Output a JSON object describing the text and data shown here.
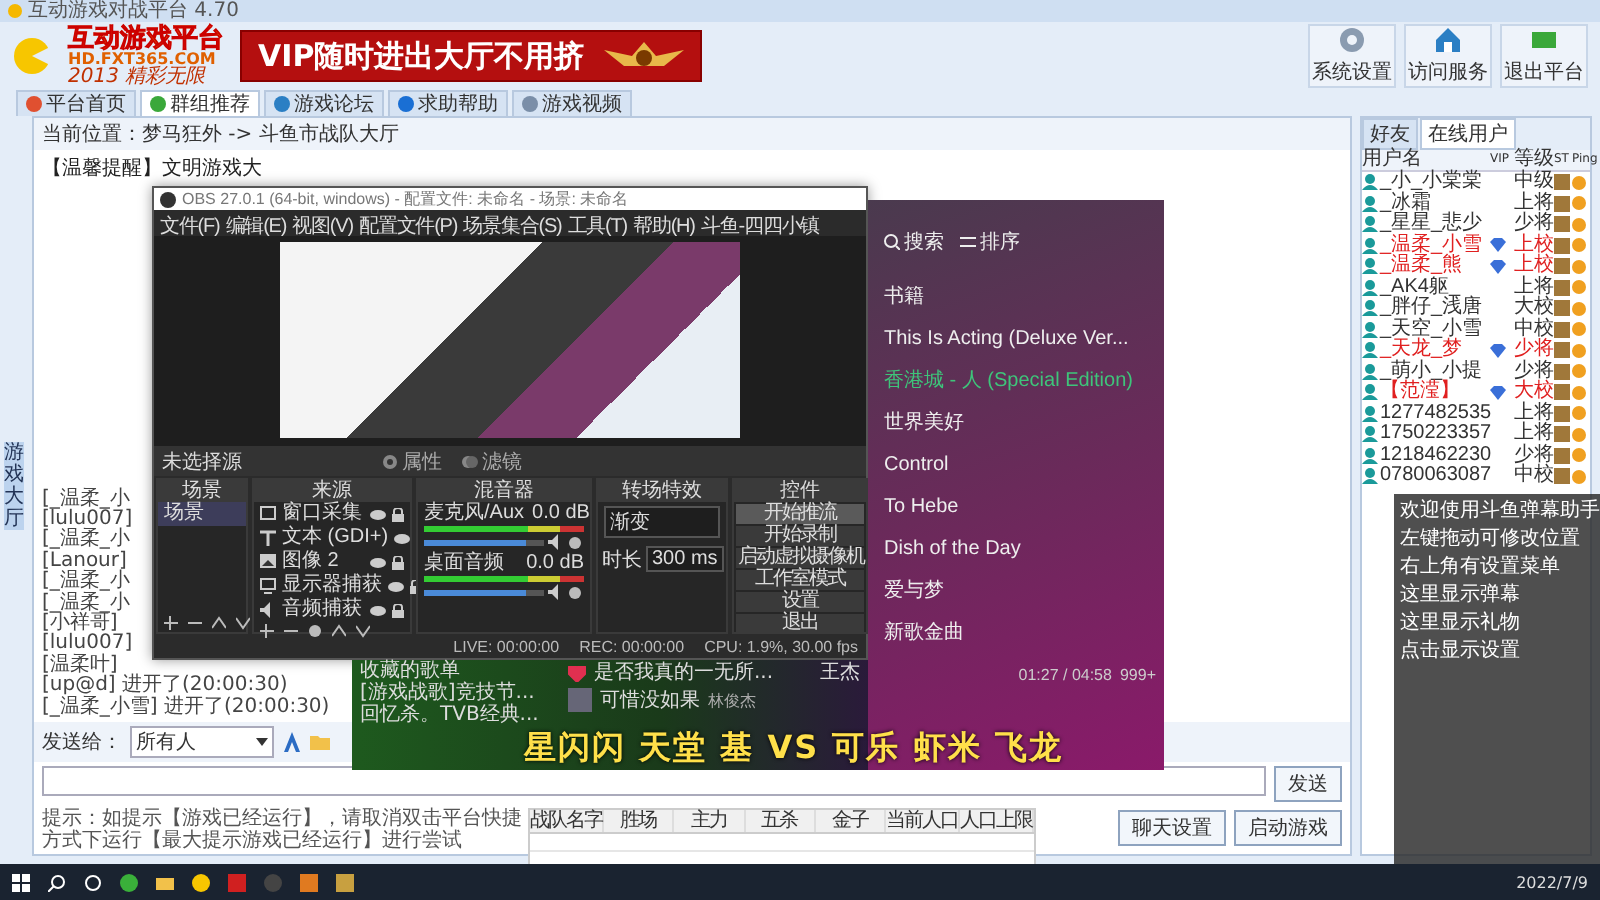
{
  "main_window": {
    "title": "互动游戏对战平台 4.70",
    "logo": {
      "brand": "互动游戏平台",
      "site": "HD.FXT365.COM",
      "slogan": "2013 精彩无限"
    },
    "banner": "VIP随时进出大厅不用挤",
    "toolbar": [
      "系统设置",
      "访问服务",
      "退出平台"
    ],
    "tabs": [
      {
        "label": "平台首页",
        "selected": false
      },
      {
        "label": "群组推荐",
        "selected": true
      },
      {
        "label": "游戏论坛",
        "selected": false
      },
      {
        "label": "求助帮助",
        "selected": false
      },
      {
        "label": "游戏视频",
        "selected": false
      }
    ],
    "breadcrumb": "当前位置：梦马狂外 -> 斗鱼市战队大厅",
    "notice": "【温馨提醒】文明游戏大",
    "side_tab": "游戏大厅",
    "chat_log": [
      "[_温柔_小",
      "[lulu007]",
      "[_温柔_小",
      "[Lanour]",
      "[_温柔_小",
      "[_温柔_小",
      "[小祥哥]",
      "[lulu007]",
      "[温柔叶]",
      "[up@d] 进开了(20:00:30)",
      "[_温柔_小雪] 进开了(20:00:30)"
    ],
    "send_to": {
      "label": "发送给：",
      "value": "所有人"
    },
    "hint": "提示：如提示【游戏已经运行】，请取消双击平台快捷方式下运行【最大提示游戏已经运行】进行尝试",
    "send_button": "发送",
    "buttons": [
      "聊天设置",
      "启动游戏"
    ],
    "user_panel": {
      "tabs": [
        {
          "label": "好友",
          "selected": false
        },
        {
          "label": "在线用户",
          "selected": true
        }
      ],
      "columns": [
        "用户名",
        "VIP",
        "等级",
        "ST",
        "Ping"
      ],
      "rows": [
        {
          "name": "_小_小棠棠",
          "rank": "中级",
          "highlight": false,
          "vip": false
        },
        {
          "name": "_冰霜",
          "rank": "上将",
          "highlight": false,
          "vip": false
        },
        {
          "name": "_星星_悲少",
          "rank": "少将",
          "highlight": false,
          "vip": false
        },
        {
          "name": "_温柔_小雪",
          "rank": "上校",
          "highlight": true,
          "vip": true
        },
        {
          "name": "_温柔_熊",
          "rank": "上校",
          "highlight": true,
          "vip": true
        },
        {
          "name": "_AK4躯_",
          "rank": "上将",
          "highlight": false,
          "vip": false
        },
        {
          "name": "_胖仔_浅唐",
          "rank": "大校",
          "highlight": false,
          "vip": false
        },
        {
          "name": "_天空_小雪",
          "rank": "中校",
          "highlight": false,
          "vip": false
        },
        {
          "name": "_天龙_梦",
          "rank": "少将",
          "highlight": true,
          "vip": true
        },
        {
          "name": "_萌小_小提",
          "rank": "少将",
          "highlight": false,
          "vip": false
        },
        {
          "name": "【范滢】",
          "rank": "大校",
          "highlight": true,
          "vip": true
        },
        {
          "name": "1277482535",
          "rank": "上将",
          "highlight": false,
          "vip": false
        },
        {
          "name": "1750223357",
          "rank": "上将",
          "highlight": false,
          "vip": false
        },
        {
          "name": "1218462230",
          "rank": "少将",
          "highlight": false,
          "vip": false
        },
        {
          "name": "0780063087",
          "rank": "中校",
          "highlight": false,
          "vip": false
        }
      ]
    }
  },
  "obs_window": {
    "title": "OBS 27.0.1 (64-bit, windows) - 配置文件: 未命名 - 场景: 未命名",
    "menu": [
      "文件(F)",
      "编辑(E)",
      "视图(V)",
      "配置文件(P)",
      "场景集合(S)",
      "工具(T)",
      "帮助(H)",
      "斗鱼-四四小镇"
    ],
    "source_bar": {
      "label": "未选择源",
      "buttons": [
        "属性",
        "滤镜"
      ]
    },
    "scenes": {
      "title": "场景",
      "items": [
        {
          "label": "场景",
          "selected": true
        }
      ]
    },
    "sources": {
      "title": "来源",
      "items": [
        {
          "label": "窗口采集",
          "kind": "window"
        },
        {
          "label": "文本 (GDI+)",
          "kind": "text"
        },
        {
          "label": "图像 2",
          "kind": "image"
        },
        {
          "label": "显示器捕获",
          "kind": "display"
        },
        {
          "label": "音频捕获",
          "kind": "audio"
        }
      ]
    },
    "mixer": {
      "title": "混音器",
      "channels": [
        {
          "name": "麦克风/Aux",
          "reading": "0.0 dB",
          "level": 0.85
        },
        {
          "name": "桌面音频",
          "reading": "0.0 dB",
          "level": 0.85
        }
      ]
    },
    "transitions": {
      "title": "转场特效",
      "value": "渐变",
      "duration_label": "时长",
      "duration": "300 ms"
    },
    "controls": {
      "title": "控件",
      "buttons": [
        {
          "label": "开始推流",
          "selected": true
        },
        {
          "label": "开始录制",
          "selected": false
        },
        {
          "label": "启动虚拟摄像机",
          "selected": false
        },
        {
          "label": "工作室模式",
          "selected": false
        },
        {
          "label": "设置",
          "selected": false
        },
        {
          "label": "退出",
          "selected": false
        }
      ]
    },
    "status": [
      "LIVE: 00:00:00",
      "REC: 00:00:00",
      "CPU: 1.9%, 30.00 fps"
    ]
  },
  "music_window": {
    "toolbar": [
      "搜索",
      "排序"
    ],
    "items": [
      {
        "title": "书籍",
        "selected": false
      },
      {
        "title": "This Is Acting (Deluxe Ver...",
        "selected": false
      },
      {
        "title": "香港城 - 人 (Special Edition)",
        "selected": true
      },
      {
        "title": "世界美好",
        "selected": false
      },
      {
        "title": "Control",
        "selected": false
      },
      {
        "title": "To Hebe",
        "selected": false
      },
      {
        "title": "Dish of the Day",
        "selected": false
      },
      {
        "title": "爱与梦",
        "selected": false
      },
      {
        "title": "新歌金曲",
        "selected": false
      }
    ],
    "time": "01:27 / 04:58",
    "comments": "999+"
  },
  "player_bar": {
    "playlists_title": "收藏的歌单",
    "playlists": [
      "[游戏战歌]竞技节...",
      "回忆杀。TVB经典..."
    ],
    "now_playing": "是否我真的一无所...",
    "artist": "王杰",
    "liked": true,
    "track": {
      "title": "可惜没如果",
      "artist": "林俊杰"
    }
  },
  "caption": "星闪闪 天堂 基 VS 可乐 虾米 飞龙",
  "sheet": {
    "columns": [
      "战队名字",
      "胜场",
      "主力",
      "五杀",
      "金子",
      "当前人口",
      "人口上限"
    ]
  },
  "danmu_overlay": [
    "欢迎使用斗鱼弹幕助手",
    "左键拖动可修改位置",
    "右上角有设置菜单",
    "这里显示弹幕",
    "这里显示礼物",
    "点击显示设置"
  ],
  "taskbar": {
    "date": "2022/7/9"
  }
}
